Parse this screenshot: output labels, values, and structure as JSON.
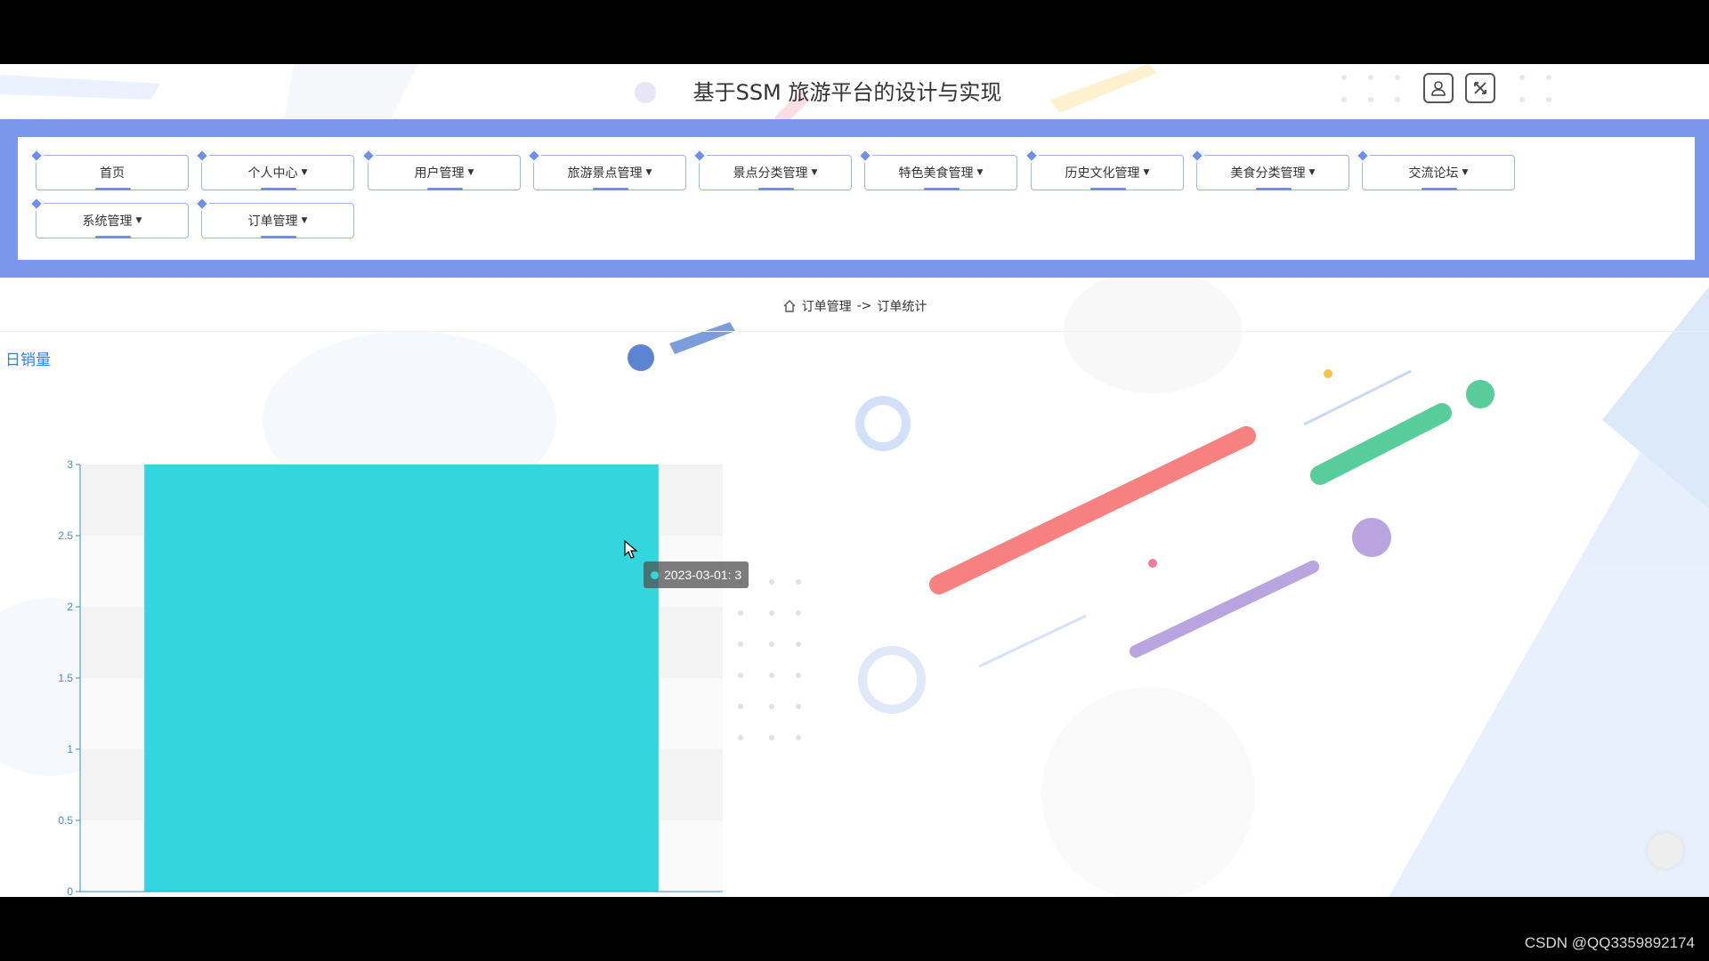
{
  "header": {
    "title": "基于SSM 旅游平台的设计与实现",
    "user_icon": "user-icon",
    "close_icon": "close-icon"
  },
  "nav": {
    "items": [
      {
        "label": "首页",
        "dropdown": false
      },
      {
        "label": "个人中心",
        "dropdown": true
      },
      {
        "label": "用户管理",
        "dropdown": true
      },
      {
        "label": "旅游景点管理",
        "dropdown": true
      },
      {
        "label": "景点分类管理",
        "dropdown": true
      },
      {
        "label": "特色美食管理",
        "dropdown": true
      },
      {
        "label": "历史文化管理",
        "dropdown": true
      },
      {
        "label": "美食分类管理",
        "dropdown": true
      },
      {
        "label": "交流论坛",
        "dropdown": true
      },
      {
        "label": "系统管理",
        "dropdown": true
      },
      {
        "label": "订单管理",
        "dropdown": true
      }
    ]
  },
  "breadcrumb": {
    "home_icon": "home-icon",
    "parent": "订单管理",
    "separator": "->",
    "current": "订单统计"
  },
  "chart_title": "日销量",
  "chart_data": {
    "type": "bar",
    "categories": [
      "2023-03-01"
    ],
    "values": [
      3
    ],
    "ylim": [
      0,
      3
    ],
    "yticks": [
      "0",
      "0.5",
      "1",
      "1.5",
      "2",
      "2.5",
      "3"
    ],
    "bar_color": "#33d6dc",
    "axis_color": "#3d8fcf",
    "grid": true
  },
  "tooltip": {
    "text": "2023-03-01: 3"
  },
  "watermark": "CSDN @QQ3359892174",
  "colors": {
    "nav_band": "#7a97ec",
    "accent": "#6f8fe8",
    "title_blue": "#2f80ed"
  }
}
